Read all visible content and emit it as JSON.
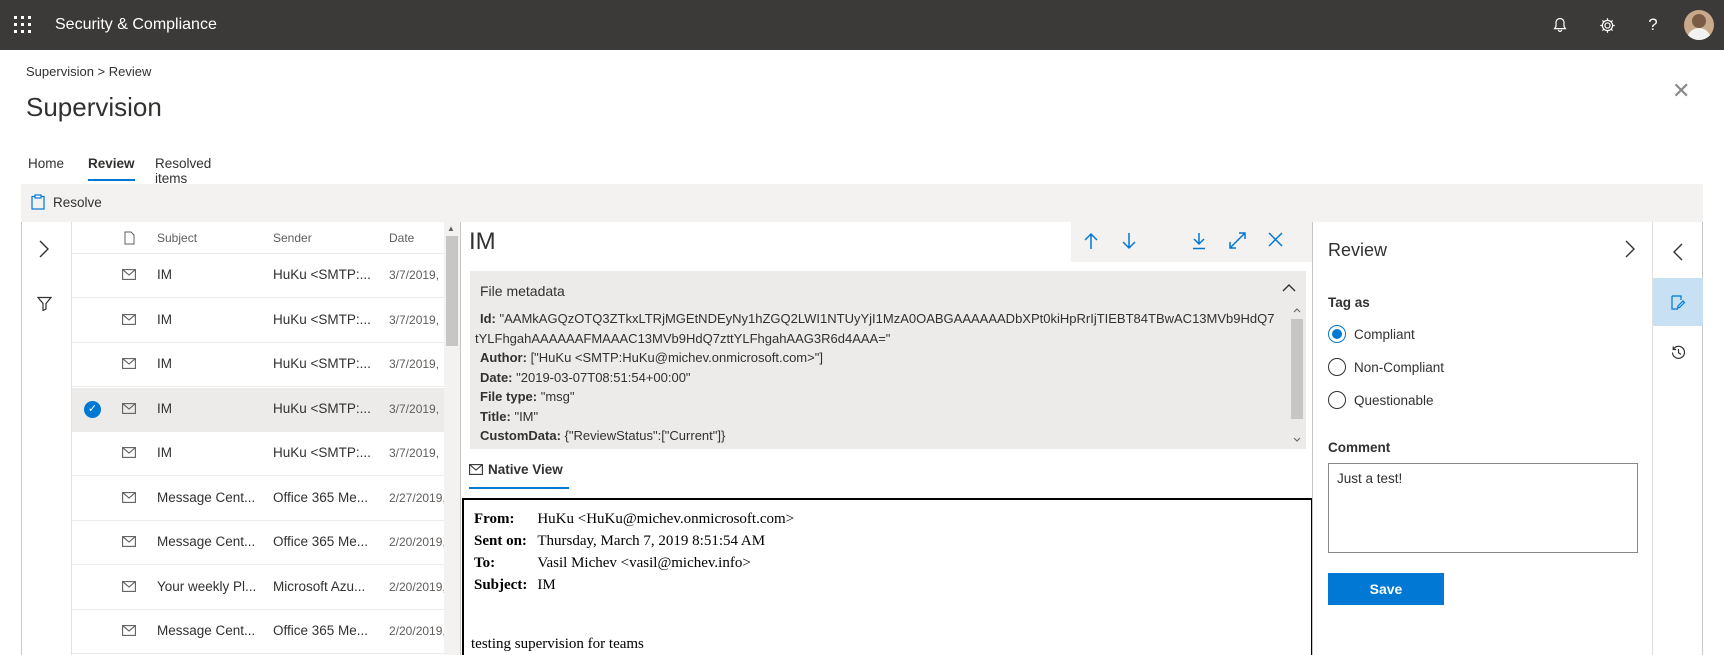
{
  "app": {
    "title": "Security & Compliance"
  },
  "header_icons": [
    "bell-icon",
    "gear-icon",
    "help-icon",
    "avatar"
  ],
  "header_help": "?",
  "breadcrumb": "Supervision > Review",
  "page_title": "Supervision",
  "tabs": [
    {
      "label": "Home",
      "active": false
    },
    {
      "label": "Review",
      "active": true
    },
    {
      "label": "Resolved items",
      "active": false
    }
  ],
  "commandbar": {
    "resolve_label": "Resolve"
  },
  "list": {
    "columns": {
      "subject": "Subject",
      "sender": "Sender",
      "date": "Date"
    },
    "rows": [
      {
        "subject": "IM",
        "sender": "HuKu <SMTP:...",
        "date": "3/7/2019,",
        "selected": false
      },
      {
        "subject": "IM",
        "sender": "HuKu <SMTP:...",
        "date": "3/7/2019,",
        "selected": false
      },
      {
        "subject": "IM",
        "sender": "HuKu <SMTP:...",
        "date": "3/7/2019,",
        "selected": false
      },
      {
        "subject": "IM",
        "sender": "HuKu <SMTP:...",
        "date": "3/7/2019,",
        "selected": true
      },
      {
        "subject": "IM",
        "sender": "HuKu <SMTP:...",
        "date": "3/7/2019,",
        "selected": false
      },
      {
        "subject": "Message Cent...",
        "sender": "Office 365 Me...",
        "date": "2/27/2019,",
        "selected": false
      },
      {
        "subject": "Message Cent...",
        "sender": "Office 365 Me...",
        "date": "2/20/2019,",
        "selected": false
      },
      {
        "subject": "Your weekly Pl...",
        "sender": "Microsoft Azu...",
        "date": "2/20/2019,",
        "selected": false
      },
      {
        "subject": "Message Cent...",
        "sender": "Office 365 Me...",
        "date": "2/20/2019,",
        "selected": false
      }
    ]
  },
  "detail": {
    "title": "IM",
    "metadata": {
      "heading": "File metadata",
      "id_label": "Id:",
      "id_value_1": "\"AAMkAGQzOTQ3ZTkxLTRjMGEtNDEyNy1hZGQ2LWI1NTUyYjI1MzA0OABGAAAAAADbXPt0kiHpRrIjTIEBT84TBwAC13MVb9HdQ7zt",
      "id_value_2": "tYLFhgahAAAAAAFMAAAC13MVb9HdQ7zttYLFhgahAAG3R6d4AAA=\"",
      "author_label": "Author:",
      "author_value": "[\"HuKu <SMTP:HuKu@michev.onmicrosoft.com>\"]",
      "date_label": "Date:",
      "date_value": "\"2019-03-07T08:51:54+00:00\"",
      "filetype_label": "File type:",
      "filetype_value": "\"msg\"",
      "title_label": "Title:",
      "title_value": "\"IM\"",
      "customdata_label": "CustomData:",
      "customdata_value": "{\"ReviewStatus\":[\"Current\"]}"
    },
    "native_view_label": "Native View",
    "email": {
      "from_label": "From:",
      "from": "HuKu <HuKu@michev.onmicrosoft.com>",
      "sent_label": "Sent on:",
      "sent": "Thursday, March 7, 2019 8:51:54 AM",
      "to_label": "To:",
      "to": "Vasil Michev <vasil@michev.info>",
      "subject_label": "Subject:",
      "subject": "IM",
      "body": "testing supervision for teams"
    }
  },
  "review": {
    "title": "Review",
    "tag_label": "Tag as",
    "options": [
      {
        "label": "Compliant",
        "checked": true
      },
      {
        "label": "Non-Compliant",
        "checked": false
      },
      {
        "label": "Questionable",
        "checked": false
      }
    ],
    "comment_label": "Comment",
    "comment_value": "Just a test!",
    "save_label": "Save"
  },
  "colors": {
    "topbar": "#3b3a39",
    "accent": "#0078d4",
    "selected_row": "#edebe9"
  }
}
